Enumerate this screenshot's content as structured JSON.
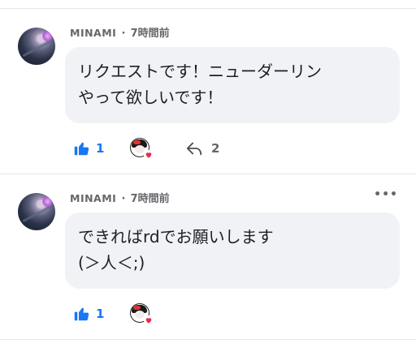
{
  "comments": [
    {
      "username": "MINAMI",
      "separator": "·",
      "time": "7時間前",
      "text_lines": [
        "リクエストです！ニューダーリン",
        "やって欲しいです！"
      ],
      "likes": "1",
      "replies": "2",
      "reaction": "heart",
      "has_more_menu": false
    },
    {
      "username": "MINAMI",
      "separator": "·",
      "time": "7時間前",
      "more_label": "•••",
      "text_lines": [
        "できればrdでお願いします",
        "(＞人＜;)"
      ],
      "likes": "1",
      "replies": "",
      "reaction": "heart",
      "has_more_menu": true
    }
  ],
  "colors": {
    "like_blue": "#1877f2",
    "bubble_bg": "#f0f2f5",
    "meta_gray": "#65676b",
    "heart_red": "#f02849"
  },
  "icons": {
    "like": "thumbs-up-icon",
    "reply": "reply-arrow-icon",
    "reaction": "heart-icon",
    "more": "more-dots-icon"
  }
}
